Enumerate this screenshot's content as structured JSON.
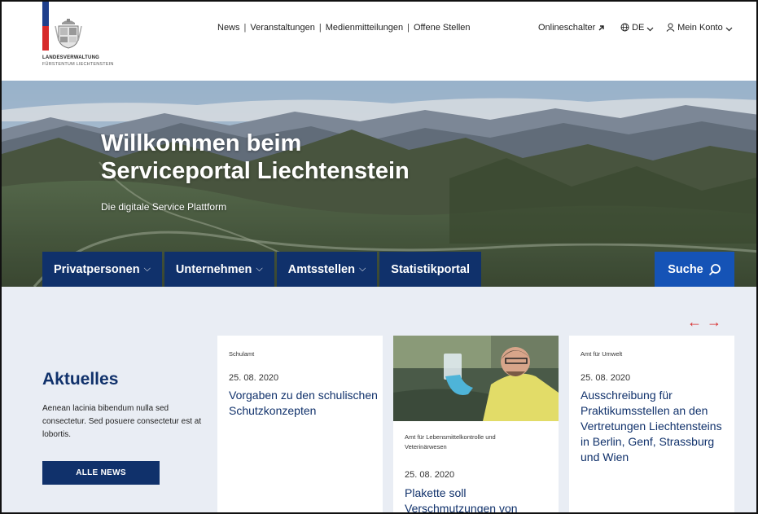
{
  "brand": {
    "line1": "LANDESVERWALTUNG",
    "line2": "FÜRSTENTUM LIECHTENSTEIN",
    "colors": {
      "blue": "#1f3f8c",
      "red": "#d72a2a"
    }
  },
  "topnav": {
    "items": [
      "News",
      "Veranstaltungen",
      "Medienmitteilungen",
      "Offene Stellen"
    ],
    "separator": "|"
  },
  "utility": {
    "online": "Onlineschalter",
    "online_icon": "external-arrow-icon",
    "lang": "DE",
    "lang_icon": "globe-icon",
    "account": "Mein Konto",
    "account_icon": "user-icon"
  },
  "hero": {
    "title_line1": "Willkommen beim",
    "title_line2": "Serviceportal Liechtenstein",
    "subtitle": "Die digitale Service Plattform"
  },
  "categories": [
    {
      "label": "Privatpersonen",
      "chevron": "⌵"
    },
    {
      "label": "Unternehmen",
      "chevron": "⌵"
    },
    {
      "label": "Amtsstellen",
      "chevron": "⌵"
    },
    {
      "label": "Statistikportal",
      "chevron": ""
    }
  ],
  "search": {
    "label": "Suche",
    "icon": "search-icon"
  },
  "news": {
    "heading": "Aktuelles",
    "intro": "Aenean lacinia bibendum nulla sed consectetur. Sed posuere consectetur est at lobortis.",
    "button": "ALLE NEWS",
    "prev": "←",
    "next": "→",
    "cards": [
      {
        "category": "Schulamt",
        "date": "25. 08. 2020",
        "title": "Vorgaben zu den schulischen Schutzkonzepten"
      },
      {
        "category": "Amt für Lebensmittelkontrolle und Veterinärwesen",
        "date": "25. 08. 2020",
        "title": "Plakette soll Verschmutzungen von"
      },
      {
        "category": "Amt für Umwelt",
        "date": "25. 08. 2020",
        "title": "Ausschreibung für Praktikumsstellen an den Vertretungen Liechtensteins in Berlin, Genf, Strassburg und Wien"
      }
    ]
  },
  "colors": {
    "navy": "#10316b",
    "accent": "#1553b6",
    "arrow_red": "#d72a2a",
    "section_bg": "#e9edf4"
  }
}
